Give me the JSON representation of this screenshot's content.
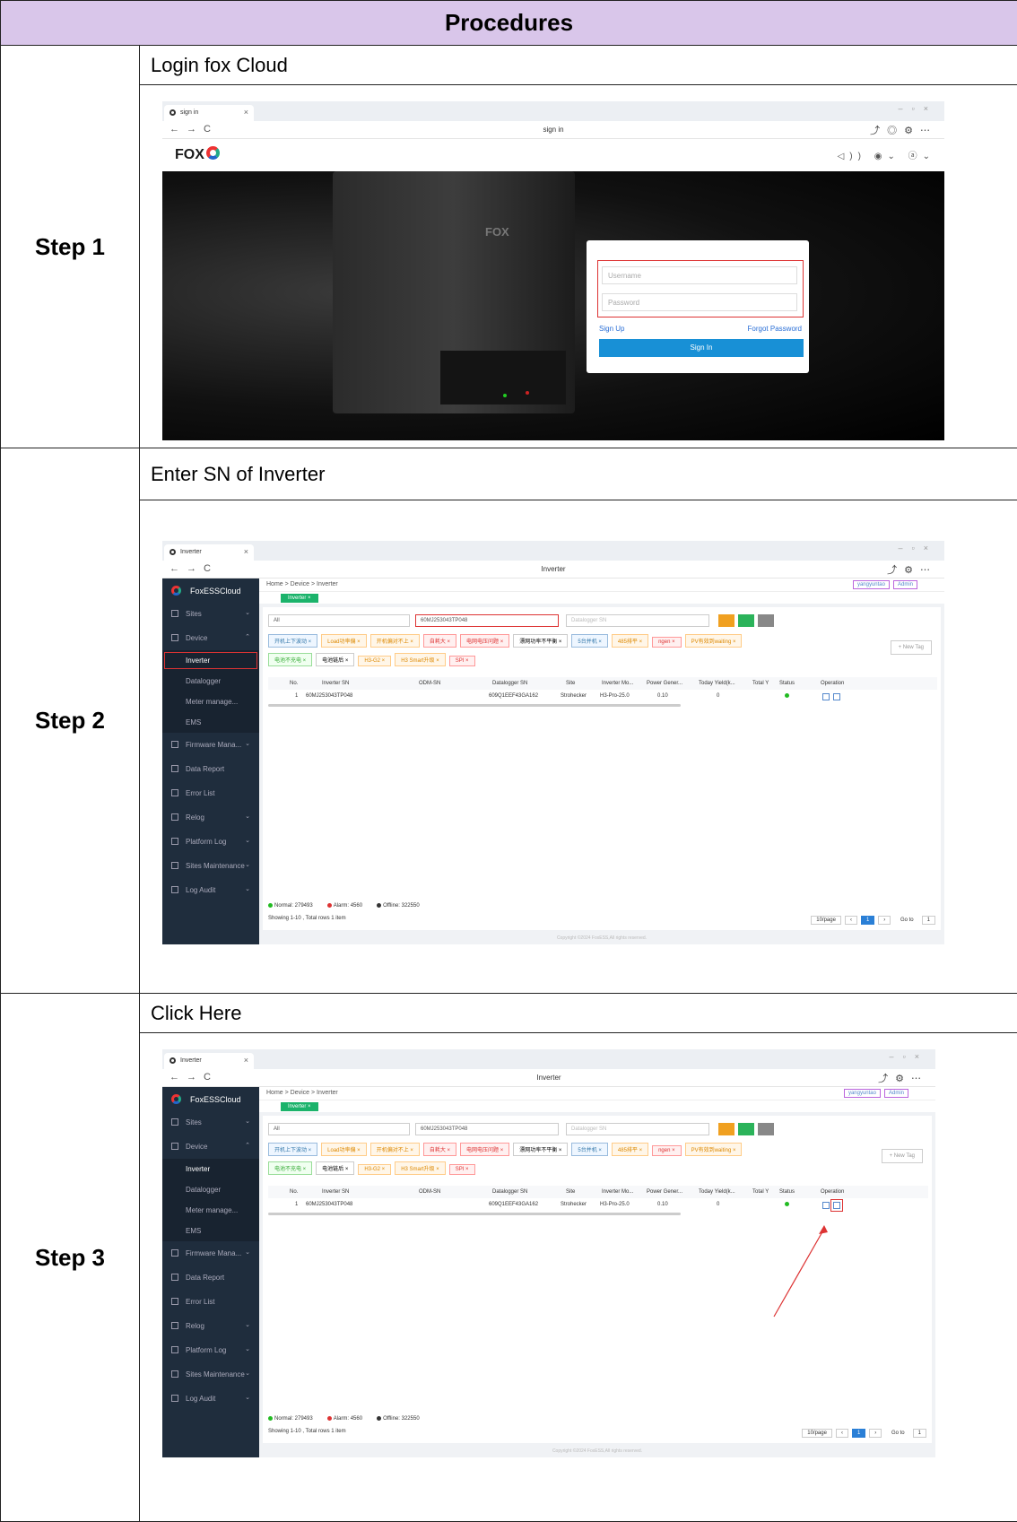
{
  "header": "Procedures",
  "steps": [
    {
      "label": "Step  1",
      "title": "Login fox Cloud"
    },
    {
      "label": "Step  2",
      "title": "Enter SN of Inverter"
    },
    {
      "label": "Step  3",
      "title": "Click Here"
    }
  ],
  "login": {
    "tab_title": "sign in",
    "url": "sign in",
    "logo": "FOX",
    "username_placeholder": "Username",
    "password_placeholder": "Password",
    "sign_up": "Sign Up",
    "forgot": "Forgot Password",
    "sign_in": "Sign In"
  },
  "app": {
    "tab_title": "Inverter",
    "url": "Inverter",
    "brand": "FoxESSCloud",
    "breadcrumb": "Home  >  Device  >  Inverter",
    "user": "yangyuntao",
    "role": "Admin",
    "active_tab": "Inverter  ×",
    "sidebar": [
      "Sites",
      "Device",
      "Inverter",
      "Datalogger",
      "Meter manage...",
      "EMS",
      "Firmware Mana...",
      "Data Report",
      "Error List",
      "Relog",
      "Platform Log",
      "Sites Maintenance",
      "Log Audit"
    ],
    "filter_all": "All",
    "sn_value": "60MJ253043TP048",
    "datalogger_placeholder": "Datalogger SN",
    "tags": [
      "开机上下波动 ×",
      "Load功率偏 ×",
      "开机偏对不上 ×",
      "自耗大 ×",
      "电网电压问题 ×",
      "漂网功率不平衡 ×",
      "5台并机 ×",
      "485排平 ×",
      "ngen ×",
      "PV有效到waiting ×",
      "电池不充电 ×",
      "电池链后 ×",
      "H3-G2 ×",
      "H3 Smart升级 ×",
      "SPI ×"
    ],
    "new_tag": "+ New Tag",
    "columns": [
      "No.",
      "Inverter SN",
      "ODM-SN",
      "Datalogger SN",
      "Site",
      "Inverter Mo...",
      "Power Gener...",
      "Today Yield(k...",
      "Total Y",
      "Status",
      "Operation"
    ],
    "row": [
      "1",
      "60MJ253043TP048",
      "",
      "609Q1EEF43GA162",
      "Strohecker",
      "H3-Pro-25.0",
      "0.10",
      "0",
      ""
    ],
    "legend": {
      "normal": "Normal: 279493",
      "alarm": "Alarm: 4560",
      "offline": "Offline: 322550"
    },
    "showing": "Showing 1-10 , Total rows 1 item",
    "per_page": "10/page",
    "page": "1",
    "goto": "Go to",
    "goto_value": "1",
    "copyright": "Copyright ©2024 FoxESS,All rights reserved."
  },
  "colors": {
    "header_bg": "#d9c6ea",
    "highlight": "#d33",
    "sidebar": "#1f2d3d",
    "accent": "#1bb36b"
  }
}
